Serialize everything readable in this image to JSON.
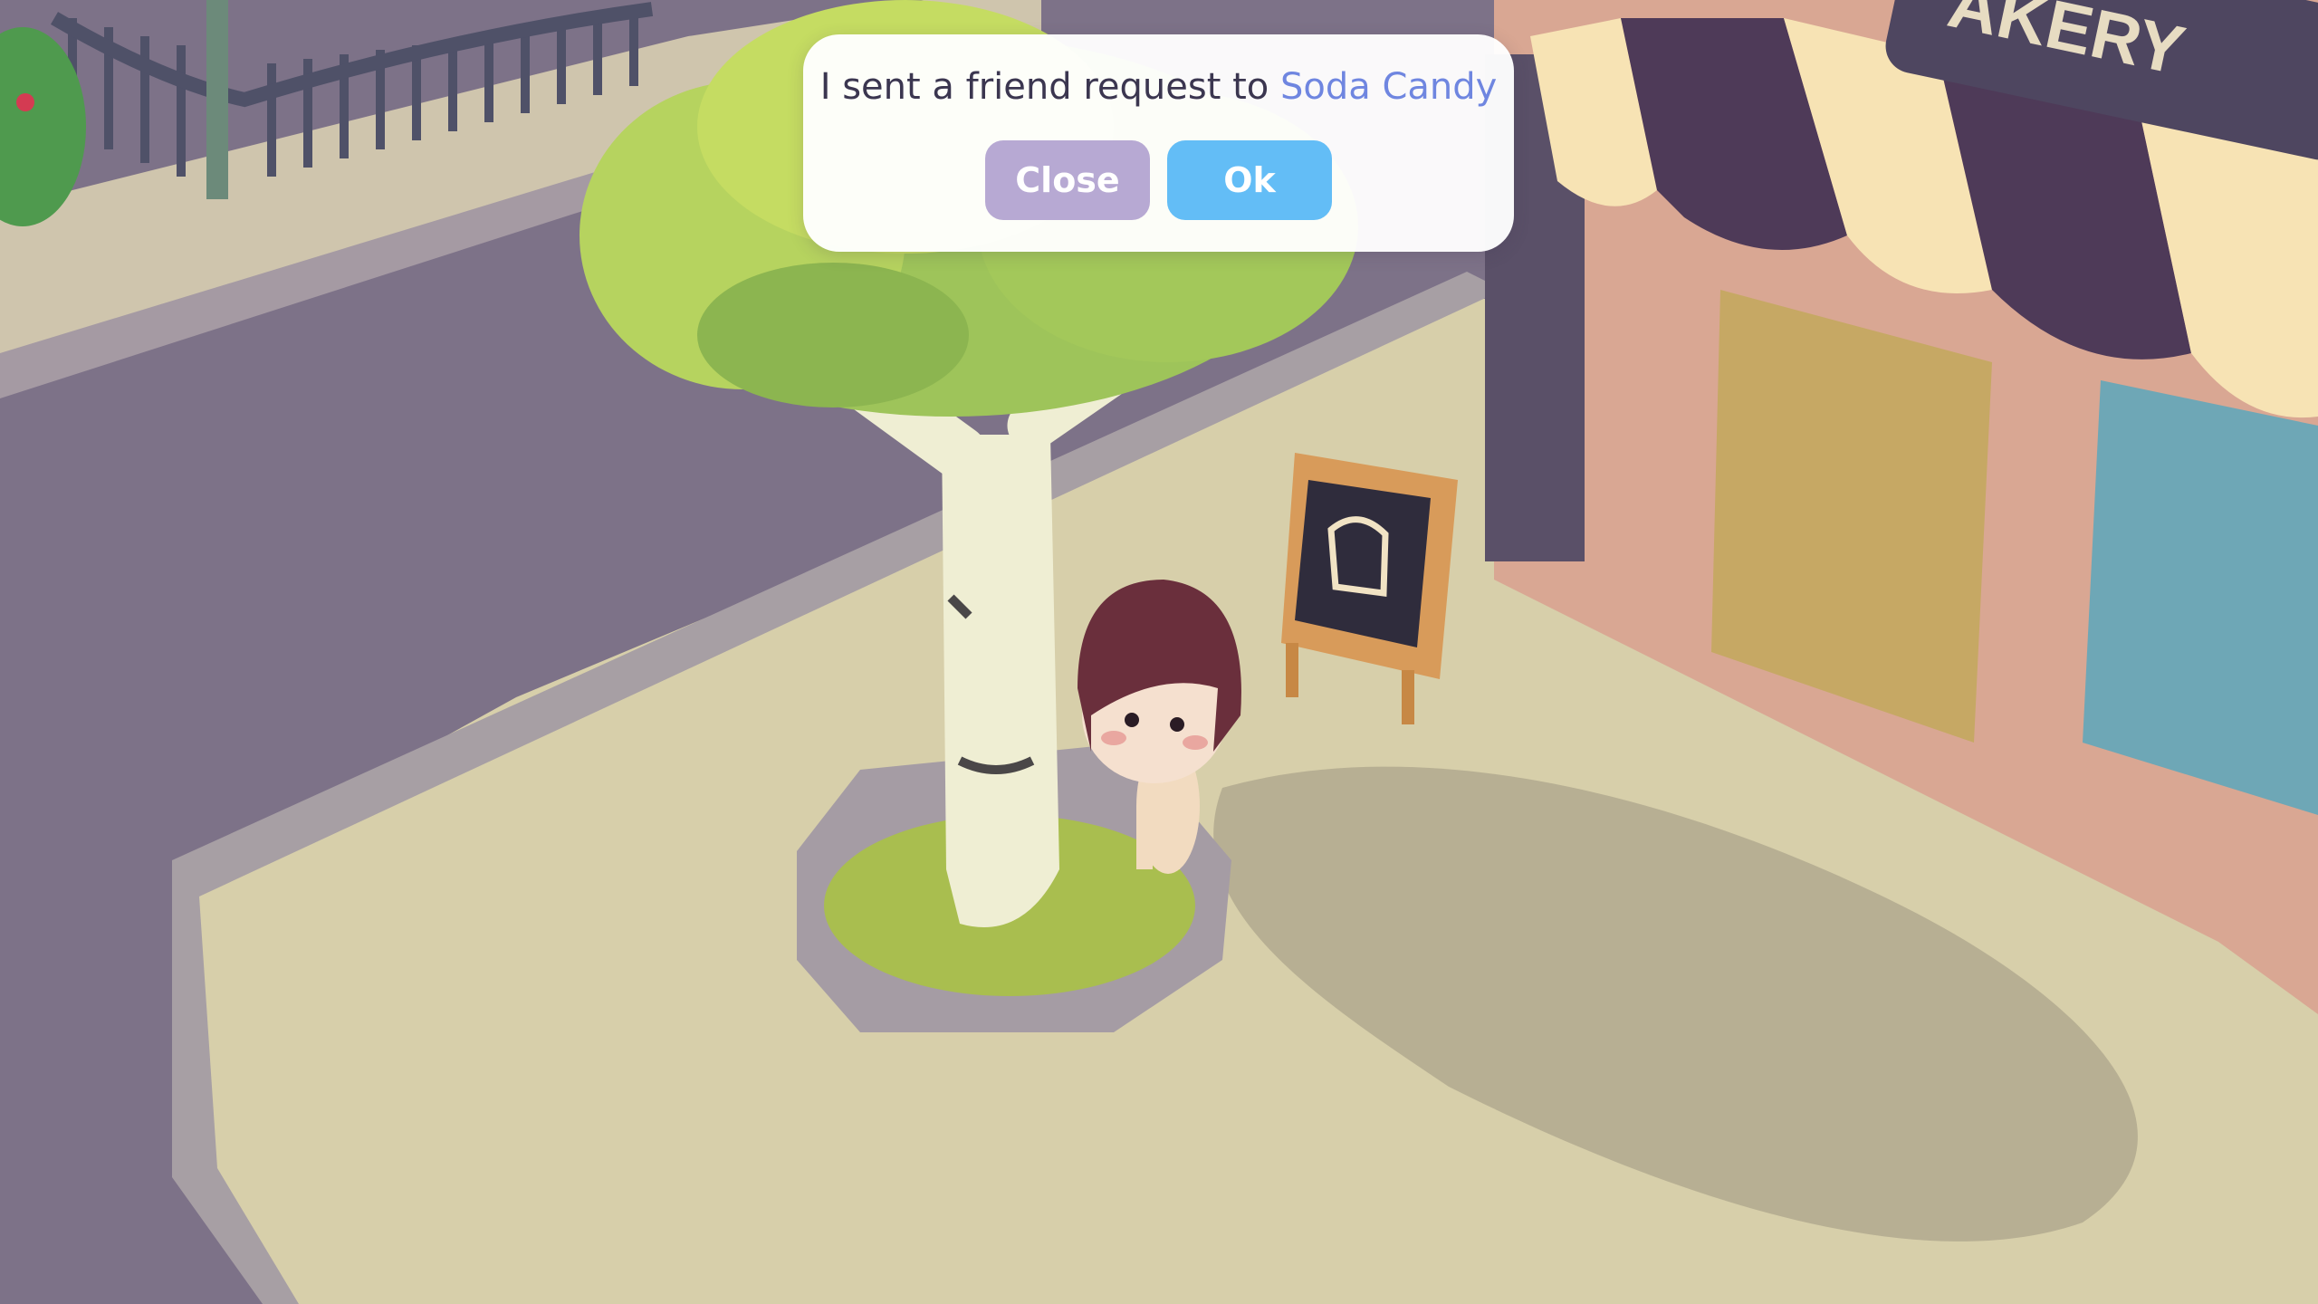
{
  "dialog": {
    "message_prefix": "I sent a friend request to ",
    "friend_name": "Soda Candy",
    "close_label": "Close",
    "ok_label": "Ok"
  },
  "scene": {
    "awning_sign_text": "AKERY",
    "colors": {
      "road": "#7d7288",
      "sidewalk": "#d7cfaa",
      "curb": "#a79fa4",
      "leaves": "#a9cf55",
      "trunk": "#efeed3",
      "hair": "#6a2f3c",
      "awning_cream": "#f7e3b4",
      "awning_plum": "#4e3a58",
      "building": "#d9a793",
      "close_button": "#b7a9d3",
      "ok_button": "#63bdf6",
      "name_highlight": "#6f86e0"
    }
  }
}
